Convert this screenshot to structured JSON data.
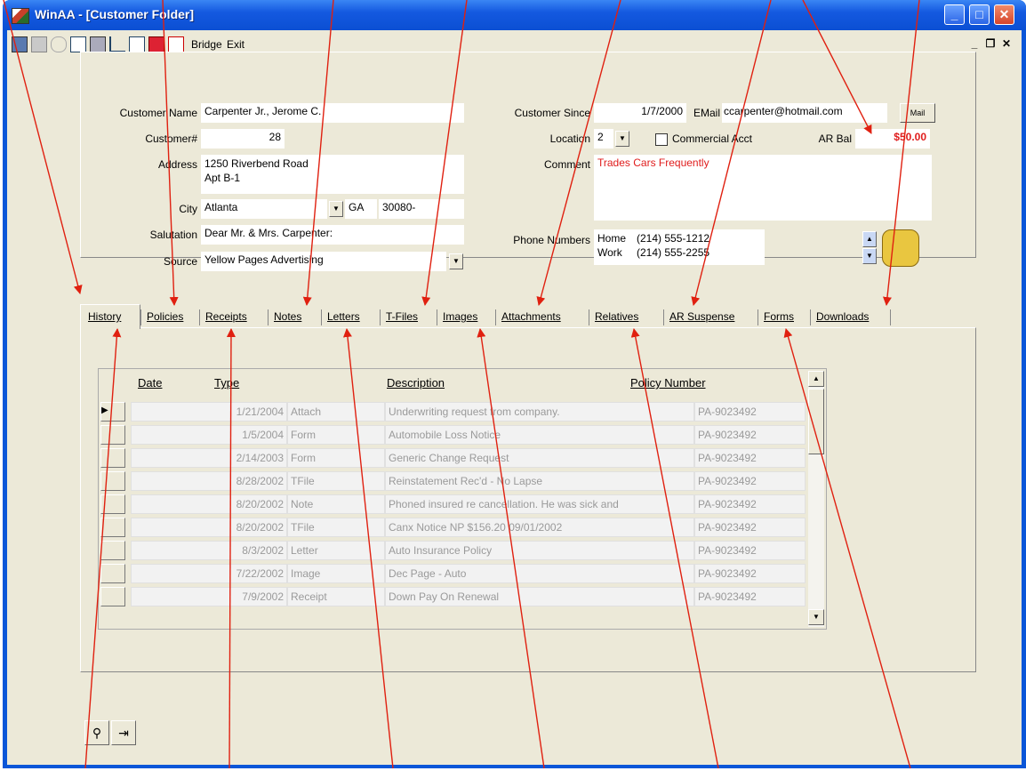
{
  "window": {
    "title": "WinAA - [Customer Folder]"
  },
  "toolbar": {
    "bridge_label": "Bridge",
    "exit_label": "Exit"
  },
  "customer": {
    "name_label": "Customer Name",
    "name": "Carpenter Jr., Jerome C.",
    "number_label": "Customer#",
    "number": "28",
    "address_label": "Address",
    "address_line1": "1250 Riverbend Road",
    "address_line2": "Apt B-1",
    "city_label": "City",
    "city": "Atlanta",
    "state": "GA",
    "zip": "30080-",
    "salutation_label": "Salutation",
    "salutation": "Dear Mr. & Mrs. Carpenter:",
    "source_label": "Source",
    "source": "Yellow Pages Advertising",
    "since_label": "Customer Since",
    "since": "1/7/2000",
    "email_label": "EMail",
    "email": "ccarpenter@hotmail.com",
    "mail_button": "Mail",
    "location_label": "Location",
    "location": "2",
    "commercial_label": "Commercial Acct",
    "ar_bal_label": "AR Bal",
    "ar_bal": "$50.00",
    "comment_label": "Comment",
    "comment": "Trades Cars Frequently",
    "phone_label": "Phone Numbers",
    "phones": [
      {
        "type": "Home",
        "number": "(214) 555-1212"
      },
      {
        "type": "Work",
        "number": "(214) 555-2255"
      }
    ]
  },
  "tabs": [
    "History",
    "Policies",
    "Receipts",
    "Notes",
    "Letters",
    "T-Files",
    "Images",
    "Attachments",
    "Relatives",
    "AR Suspense",
    "Forms",
    "Downloads"
  ],
  "history": {
    "columns": [
      "Date",
      "Type",
      "Description",
      "Policy Number"
    ],
    "rows": [
      [
        "1/21/2004",
        "Attach",
        "Underwriting request from company.",
        "PA-9023492"
      ],
      [
        "1/5/2004",
        "Form",
        "Automobile Loss Notice",
        "PA-9023492"
      ],
      [
        "2/14/2003",
        "Form",
        "Generic Change Request",
        "PA-9023492"
      ],
      [
        "8/28/2002",
        "TFile",
        "Reinstatement Rec'd - No Lapse",
        "PA-9023492"
      ],
      [
        "8/20/2002",
        "Note",
        "Phoned insured re cancellation.  He was sick and",
        "PA-9023492"
      ],
      [
        "8/20/2002",
        "TFile",
        "Canx Notice NP $156.20 09/01/2002",
        "PA-9023492"
      ],
      [
        "8/3/2002",
        "Letter",
        "Auto Insurance Policy",
        "PA-9023492"
      ],
      [
        "7/22/2002",
        "Image",
        "Dec Page - Auto",
        "PA-9023492"
      ],
      [
        "7/9/2002",
        "Receipt",
        "Down Pay On Renewal",
        "PA-9023492"
      ]
    ]
  },
  "colors": {
    "annotation": "#e02010",
    "titlebar": "#0b4fd3",
    "window_bg": "#ece9d8",
    "ar_bal": "#e01c1c"
  }
}
